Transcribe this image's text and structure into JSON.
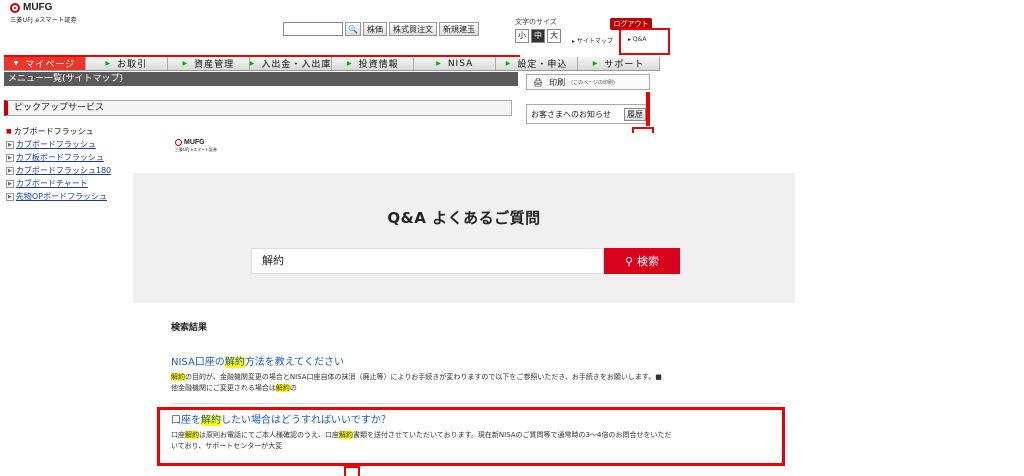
{
  "site": {
    "logo_text": "MUFG",
    "logo_sub": "三菱UFJ eスマート証券",
    "top_search": {
      "btn1": "株価",
      "btn2": "株式買注文",
      "btn3": "新規建玉"
    },
    "fontsize": {
      "label": "文字のサイズ",
      "small": "小",
      "medium": "中",
      "large": "大"
    },
    "logout": "ログアウト",
    "sitemap": "▸ サイトマップ",
    "qa_link": "▸ Q&A",
    "nav": [
      "マイページ",
      "お取引",
      "資産管理",
      "入出金・入出庫",
      "投資情報",
      "NISA",
      "設定・申込",
      "サポート"
    ],
    "subnav": "メニュー一覧(サイトマップ)",
    "print": {
      "label": "印刷",
      "note": "(このページの印刷)"
    },
    "notice": {
      "label": "お客さまへのお知らせ",
      "history": "履歴"
    },
    "pickup": "ピックアップサービス",
    "sidebar": {
      "head": "カブボードフラッシュ",
      "links": [
        "カブボードフラッシュ",
        "カブ板ボードフラッシュ",
        "カブボードフラッシュ180",
        "カブボードチャート",
        "先物OPボードフラッシュ"
      ]
    }
  },
  "qa": {
    "logo_text": "MUFG",
    "logo_sub": "三菱UFJ eスマート証券",
    "title": "Q&A よくあるご質問",
    "search_value": "解約",
    "search_button": "検索",
    "results_heading": "検索結果",
    "results": [
      {
        "title_pre": "NISA口座の",
        "title_hl": "解約",
        "title_post": "方法を教えてください",
        "d_hl1": "解約",
        "d_mid1": "の目的が、金融機関変更の場合とNISA口座自体の抹消（廃止等）によりお手続きが変わりますので以下をご参照いただき、お手続きをお願いします。■",
        "d_line2_pre": "他金融機関にご変更される場合は",
        "d_hl2": "解約",
        "d_line2_post": "の"
      },
      {
        "title_pre": "口座を",
        "title_hl": "解約",
        "title_post": "したい場合はどうすればいいですか？",
        "d_pre": "口座",
        "d_hl1": "解約",
        "d_mid1": "は原則お電話にてご本人様確認のうえ、口座",
        "d_hl2": "解約",
        "d_mid2": "書類を送付させていただいております。現在新NISAのご質問等で通常時の3〜4倍のお問合せをいただ",
        "d_line2": "いており、サポートセンターが大変"
      }
    ]
  },
  "colors": {
    "brand_red": "#d9001b",
    "link_blue": "#1e5bc6",
    "highlight": "#ffff00",
    "annotation": "#ee0000"
  }
}
